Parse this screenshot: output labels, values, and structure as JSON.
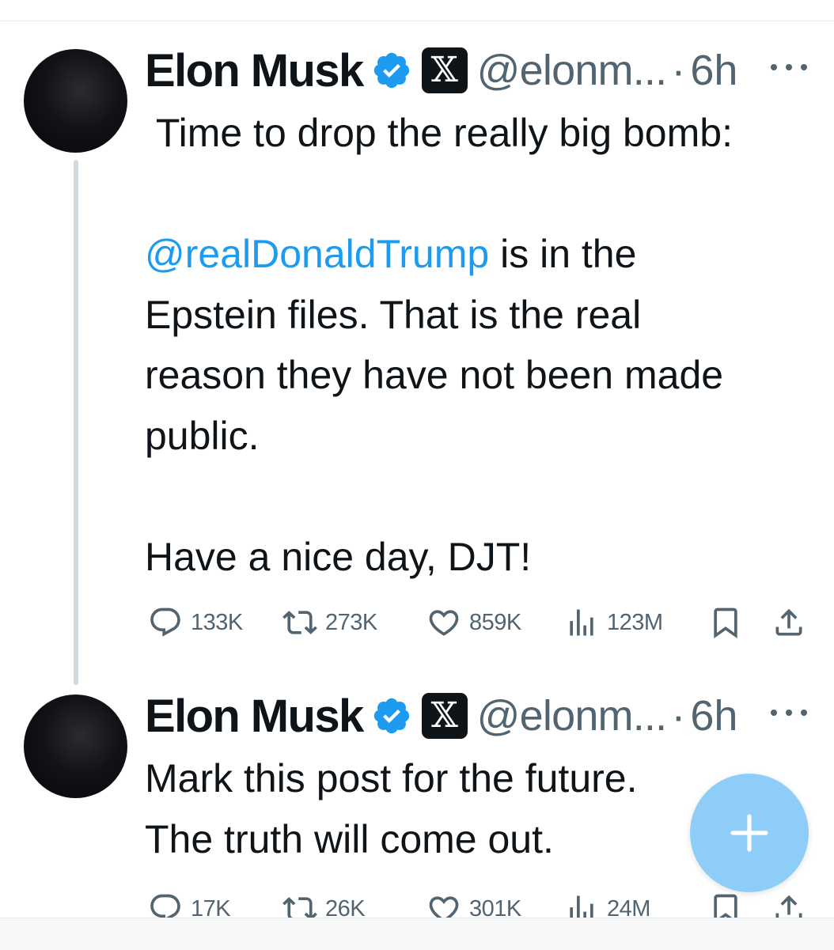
{
  "tweets": [
    {
      "author_name": "Elon Musk",
      "handle": "@elonm...",
      "separator": "·",
      "time": "6h",
      "body": [
        [
          "",
          "Time to drop the really big bomb:"
        ],
        [
          "",
          ""
        ],
        [
          "@realDonaldTrump",
          " is in the"
        ],
        [
          "",
          "Epstein files. That is the real"
        ],
        [
          "",
          "reason they have not been made"
        ],
        [
          "",
          "public."
        ],
        [
          "",
          ""
        ],
        [
          "",
          "Have a nice day, DJT!"
        ]
      ],
      "stats": {
        "replies": "133K",
        "reposts": "273K",
        "likes": "859K",
        "views": "123M"
      }
    },
    {
      "author_name": "Elon Musk",
      "handle": "@elonm...",
      "separator": "·",
      "time": "6h",
      "body": [
        [
          "",
          "Mark this post for the future."
        ],
        [
          "",
          "The truth will come out."
        ]
      ],
      "stats": {
        "replies": "17K",
        "reposts": "26K",
        "likes": "301K",
        "views": "24M"
      }
    }
  ],
  "icons": {
    "verified": "verified-badge-icon",
    "affiliation": "x-logo-icon",
    "more": "more-icon",
    "reply": "reply-icon",
    "repost": "repost-icon",
    "like": "heart-icon",
    "views": "views-icon",
    "bookmark": "bookmark-icon",
    "share": "share-icon",
    "compose": "plus-icon"
  },
  "affiliation_glyph": "𝕏",
  "colors": {
    "text": "#0f1419",
    "secondary": "#536471",
    "accent": "#1d9bf0",
    "fab": "#8ecdf8",
    "thread_line": "#cfd9de"
  }
}
